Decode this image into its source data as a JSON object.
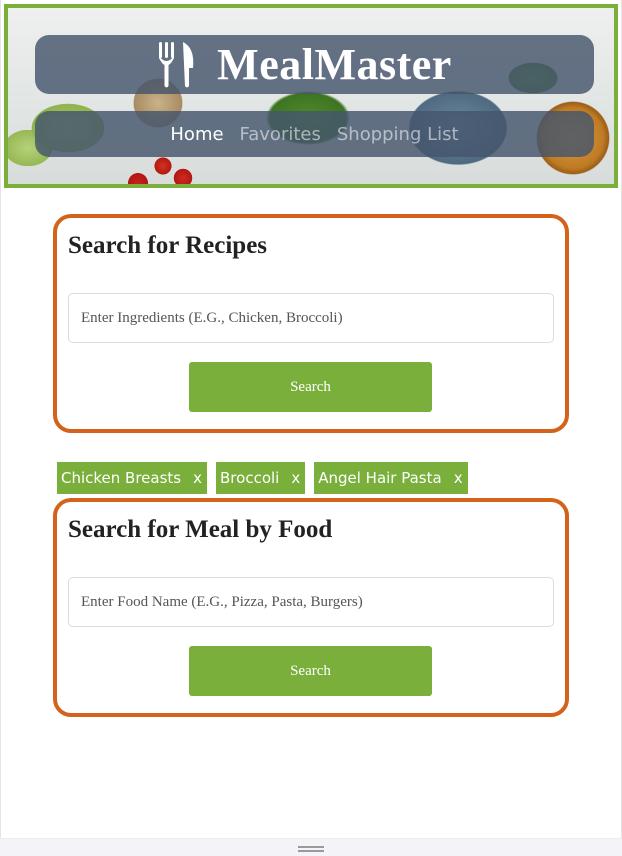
{
  "header": {
    "brand": "MealMaster",
    "nav": [
      {
        "label": "Home",
        "active": true
      },
      {
        "label": "Favorites",
        "active": false
      },
      {
        "label": "Shopping List",
        "active": false
      }
    ]
  },
  "recipe_search": {
    "title": "Search for Recipes",
    "placeholder": "Enter Ingredients (E.G., Chicken, Broccoli)",
    "button": "Search"
  },
  "tags": [
    {
      "label": "Chicken Breasts",
      "remove": "x"
    },
    {
      "label": "Broccoli",
      "remove": "x"
    },
    {
      "label": "Angel Hair Pasta",
      "remove": "x"
    }
  ],
  "food_search": {
    "title": "Search for Meal by Food",
    "placeholder": "Enter Food Name (E.G., Pizza, Pasta, Burgers)",
    "button": "Search"
  },
  "colors": {
    "accent_green": "#7aaf3c",
    "card_border_orange": "#d4621b",
    "header_overlay": "#46566c"
  }
}
